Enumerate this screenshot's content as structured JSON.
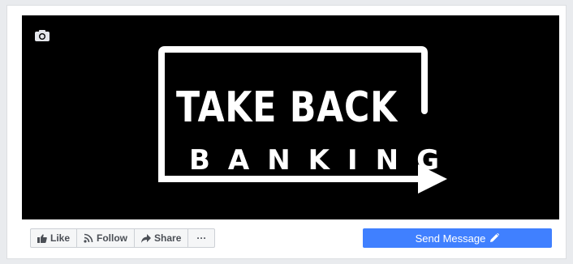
{
  "cover": {
    "camera_icon": "camera-icon",
    "logo": {
      "line1": "TAKE BACK",
      "line2": "BANKING"
    }
  },
  "actions": {
    "like": {
      "label": "Like",
      "icon": "thumbs-up-icon"
    },
    "follow": {
      "label": "Follow",
      "icon": "rss-icon"
    },
    "share": {
      "label": "Share",
      "icon": "share-arrow-icon"
    },
    "more": {
      "label": "···",
      "icon": "more-icon"
    },
    "send_message": {
      "label": "Send Message",
      "icon": "pencil-icon"
    }
  },
  "colors": {
    "cover_background": "#000000",
    "primary_button": "#4080ff",
    "button_text": "#4b4f56"
  }
}
